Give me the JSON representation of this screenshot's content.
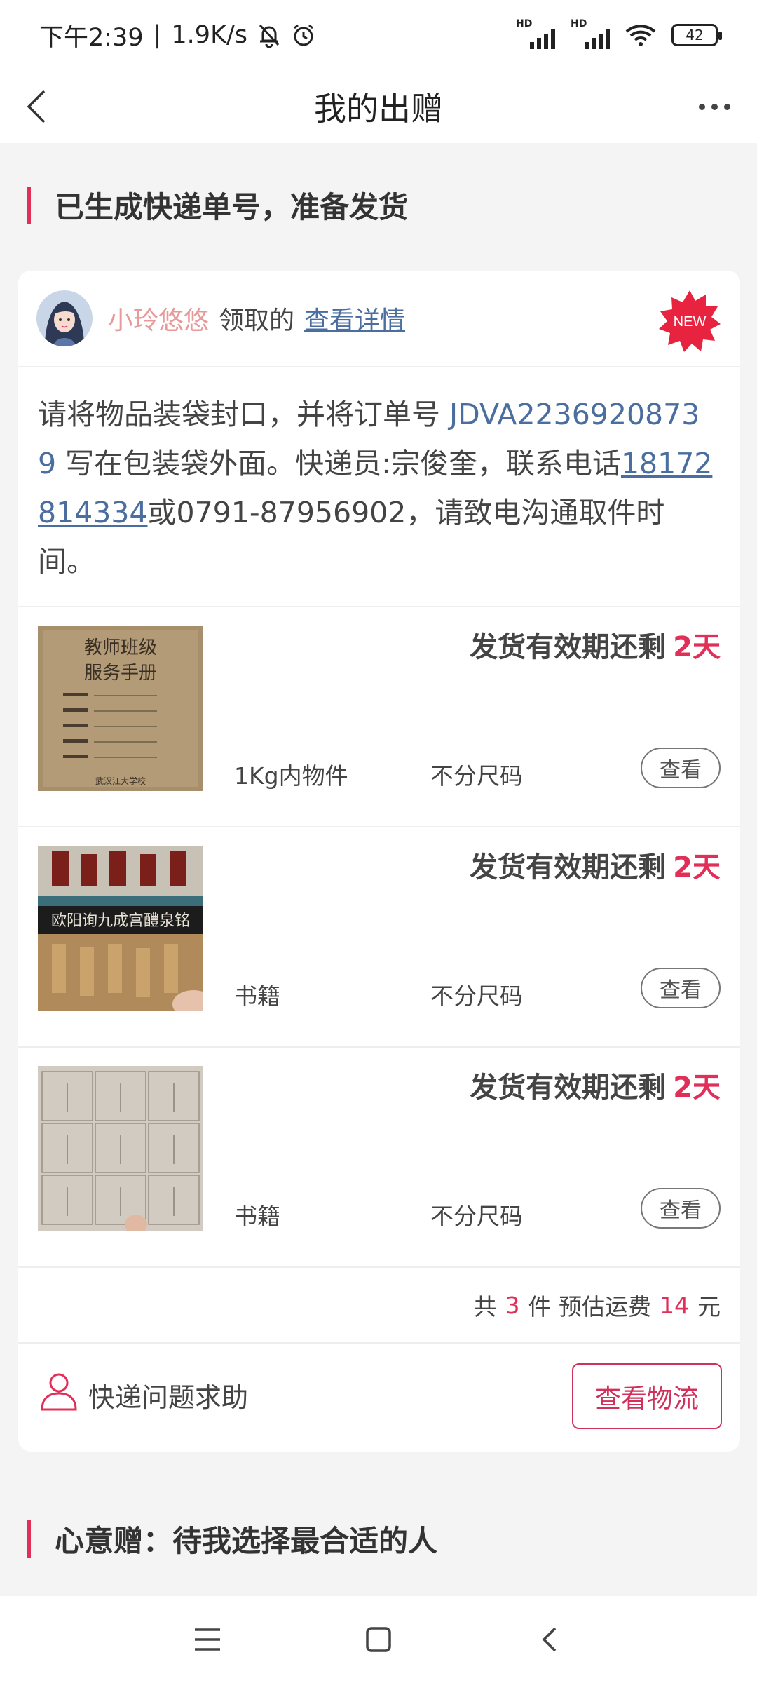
{
  "status_bar": {
    "time": "下午2:39",
    "speed": "1.9K/s",
    "signal_label_1": "HD",
    "signal_label_2": "HD",
    "battery": "42",
    "icons": [
      "mute-bell-icon",
      "alarm-icon",
      "signal-icon",
      "signal-icon",
      "wifi-icon",
      "battery-icon"
    ]
  },
  "nav": {
    "title": "我的出赠",
    "back_icon": "back-arrow-icon",
    "more_icon": "more-dots-icon"
  },
  "section1": {
    "title": "已生成快递单号，准备发货"
  },
  "card": {
    "receiver": "小玲悠悠",
    "receive_verb": "领取的",
    "detail_link": "查看详情",
    "new_badge": "NEW",
    "instruction": {
      "part1": "请将物品装袋封口，并将订单号 ",
      "order_no": "JDVA22369208739",
      "part2": " 写在包装袋外面。快递员:宗俊奎，联系电话",
      "phone": "18172814334",
      "part3": "或0791-87956902，请致电沟通取件时间。"
    },
    "items": [
      {
        "deadline_label": "发货有效期还剩",
        "deadline_days": "2天",
        "category": "1Kg内物件",
        "size": "不分尺码",
        "view_label": "查看",
        "thumb_title_1": "教师班级",
        "thumb_title_2": "服务手册",
        "thumb_footer": "武汉江大学校"
      },
      {
        "deadline_label": "发货有效期还剩",
        "deadline_days": "2天",
        "category": "书籍",
        "size": "不分尺码",
        "view_label": "查看",
        "thumb_band": "欧阳询九成宫醴泉铭"
      },
      {
        "deadline_label": "发货有效期还剩",
        "deadline_days": "2天",
        "category": "书籍",
        "size": "不分尺码",
        "view_label": "查看"
      }
    ],
    "summary": {
      "prefix": "共",
      "count": "3",
      "unit": "件 预估运费",
      "fee": "14",
      "currency": "元"
    },
    "help_text": "快递问题求助",
    "logistics_button": "查看物流"
  },
  "section2": {
    "title": "心意赠：待我选择最合适的人"
  },
  "system_nav": [
    "menu-icon",
    "home-icon",
    "back-icon"
  ],
  "colors": {
    "accent": "#e0305a",
    "link": "#4a6e9f",
    "receiver": "#e89a9a"
  }
}
